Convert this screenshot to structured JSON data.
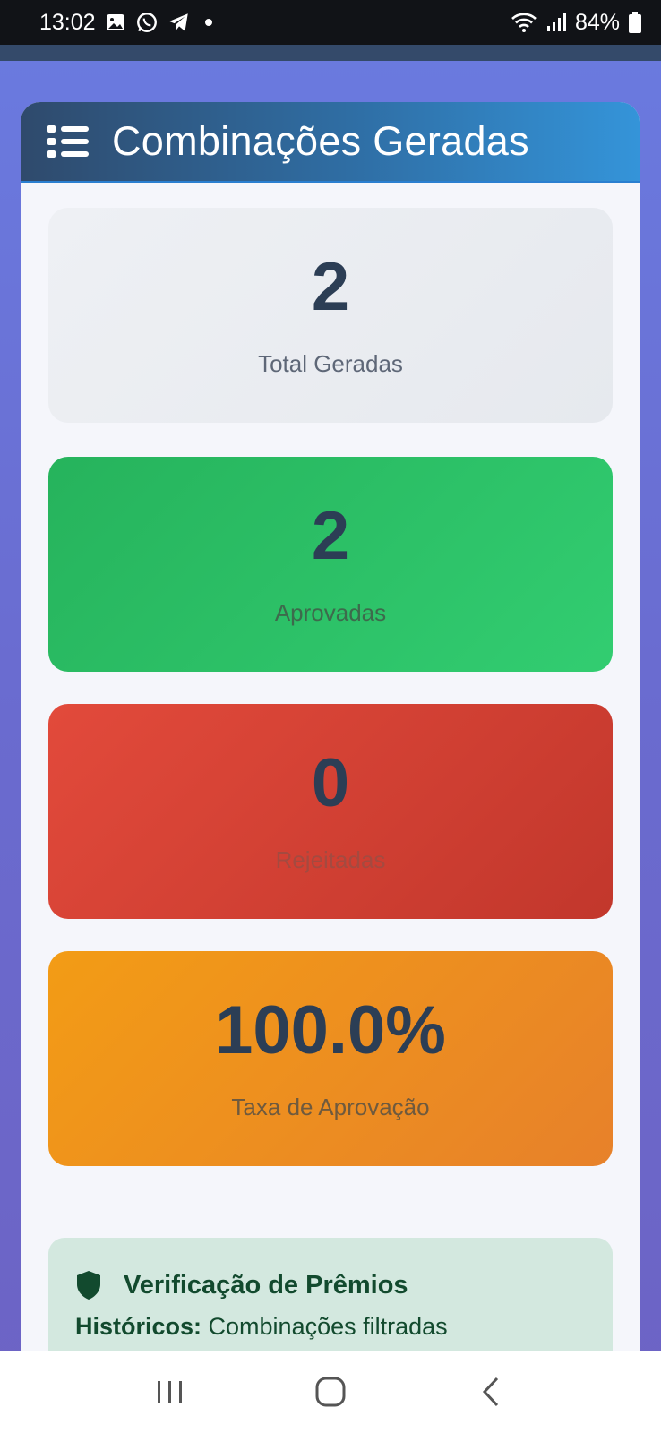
{
  "status_bar": {
    "time": "13:02",
    "battery": "84%"
  },
  "header": {
    "title": "Combinações Geradas",
    "icon": "list-icon"
  },
  "stats": {
    "total": {
      "value": "2",
      "label": "Total Geradas"
    },
    "approved": {
      "value": "2",
      "label": "Aprovadas"
    },
    "rejected": {
      "value": "0",
      "label": "Rejeitadas"
    },
    "rate": {
      "value": "100.0%",
      "label": "Taxa de Aprovação"
    }
  },
  "verification": {
    "icon": "shield-icon",
    "title": "Verificação de Prêmios",
    "body_label": "Históricos:",
    "body_text": " Combinações filtradas"
  },
  "nav": {
    "recent_icon": "recent-apps-icon",
    "home_icon": "home-icon",
    "back_icon": "back-icon"
  },
  "colors": {
    "header_start": "#2f4a6c",
    "header_end": "#3494d9",
    "approved": "#2ecc71",
    "rejected": "#d64235",
    "rate": "#f0901f"
  }
}
